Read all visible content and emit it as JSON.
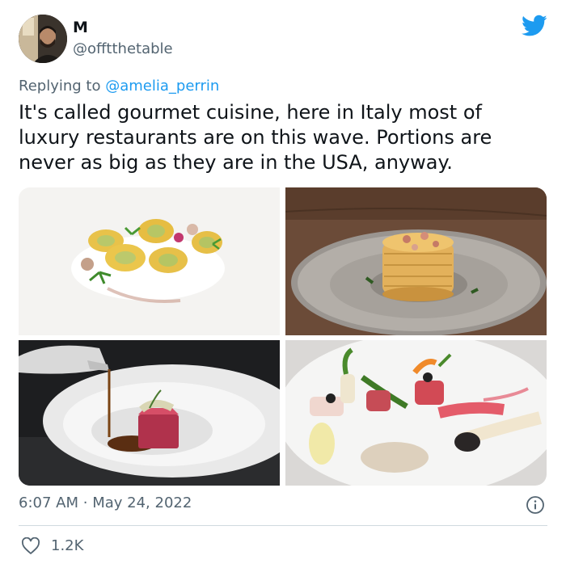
{
  "author": {
    "display_name": "M",
    "handle": "@offtthetable"
  },
  "reply": {
    "prefix": "Replying to",
    "mention": "@amelia_perrin"
  },
  "tweet": {
    "text": "It's called gourmet cuisine, here in Italy most of luxury restaurants are on this wave. Portions are never as big as they are in the USA, anyway."
  },
  "meta": {
    "time": "6:07 AM",
    "separator": "·",
    "date": "May 24, 2022"
  },
  "engagement": {
    "likes": "1.2K"
  },
  "icons": {
    "brand": "twitter-bird-icon",
    "info": "info-icon",
    "like": "heart-outline-icon"
  },
  "colors": {
    "accent": "#1d9bf0",
    "secondary_text": "#536471",
    "primary_text": "#0f1419",
    "divider": "#cfd9de"
  }
}
